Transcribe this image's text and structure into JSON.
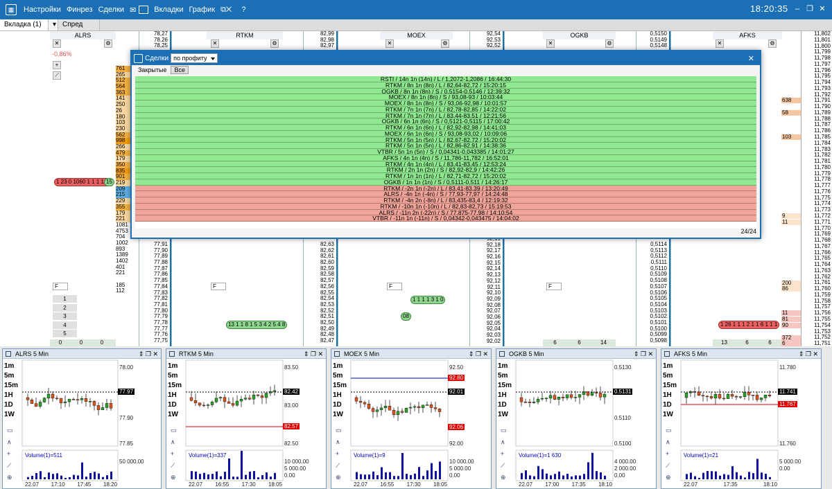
{
  "menu": {
    "items": [
      "Настройки",
      "Финрез",
      "Сделки",
      "Вкладки",
      "График"
    ],
    "clock": "18:20:35",
    "help": "?"
  },
  "tabs": {
    "tab1": "Вкладка (1)",
    "tab2": "Спред"
  },
  "instruments": [
    {
      "name": "ALRS",
      "change": "-0,86%"
    },
    {
      "name": "RTKM"
    },
    {
      "name": "MOEX"
    },
    {
      "name": "OGKB"
    },
    {
      "name": "AFKS"
    }
  ],
  "dialog": {
    "title": "Сделки",
    "filter": "по профиту",
    "sub_closed": "Закрытые",
    "sub_all": "Все",
    "counter": "24/24",
    "deals": [
      {
        "text": "RSTI / 14n 1n (14n) / L / 1,2072-1,2086 / 16:44:30",
        "result": "win"
      },
      {
        "text": "RTKM / 8n 1n (8n) / L / 82,64-82,72 / 15:20:15",
        "result": "win"
      },
      {
        "text": "OGKB / 8n 1n (8n) / S / 0,5154-0,5146 / 12:39:32",
        "result": "win"
      },
      {
        "text": "MOEX / 8n 1n (8n) / S / 93,08-93 / 10:03:44",
        "result": "win"
      },
      {
        "text": "MOEX / 8n 1n (8n) / S / 93,06-92,98 / 10:01:57",
        "result": "win"
      },
      {
        "text": "RTKM / 7n 1n (7n) / L / 82,78-82,85 / 14:22:02",
        "result": "win"
      },
      {
        "text": "RTKM / 7n 1n (7n) / L / 83,44-83,51 / 12:21:56",
        "result": "win"
      },
      {
        "text": "OGKB / 6n 1n (6n) / S / 0,5121-0,5115 / 17:00:42",
        "result": "win"
      },
      {
        "text": "RTKM / 6n 1n (6n) / L / 82,92-82,98 / 14:41:03",
        "result": "win"
      },
      {
        "text": "MOEX / 6n 1n (6n) / S / 93,08-93,02 / 10:09:06",
        "result": "win"
      },
      {
        "text": "RTKM / 5n 1n (5n) / L / 82,67-82,72 / 15:20:02",
        "result": "win"
      },
      {
        "text": "RTKM / 5n 1n (5n) / L / 82,86-82,91 / 14:38:36",
        "result": "win"
      },
      {
        "text": "VTBR / 5n 1n (5n) / S / 0,04341-0,043385 / 14:01:27",
        "result": "win"
      },
      {
        "text": "AFKS / 4n 1n (4n) / S / 11,786-11,782 / 16:52:01",
        "result": "win"
      },
      {
        "text": "RTKM / 4n 1n (4n) / L / 83,41-83,45 / 12:53:24",
        "result": "win"
      },
      {
        "text": "RTKM / 2n 1n (2n) / S / 82,92-82,9 / 14:42:26",
        "result": "win"
      },
      {
        "text": "RTKM / 1n 1n (1n) / L / 82,71-82,72 / 15:20:02",
        "result": "win"
      },
      {
        "text": "OGKB / 1n 1n (1n) / S / 0,5111-0,511 / 14:26:17",
        "result": "win"
      },
      {
        "text": "RTKM / -2n 1n (-2n) / L / 83,41-83,39 / 13:20:49",
        "result": "loss"
      },
      {
        "text": "ALRS / -4n 1n (-4n) / S / 77,93-77,97 / 14:24:48",
        "result": "loss"
      },
      {
        "text": "RTKM / -4n 2n (-8n) / L / 83,435-83,4 / 12:19:32",
        "result": "loss"
      },
      {
        "text": "RTKM / -10n 1n (-10n) / L / 82,83-82,73 / 15:19:53",
        "result": "loss"
      },
      {
        "text": "ALRS / -11n 2n (-22n) / S / 77,875-77,98 / 14:10:54",
        "result": "loss"
      },
      {
        "text": "VTBR / -11n 1n (-11n) / S / 0,04342-0,043475 / 14:04:02",
        "result": "loss"
      }
    ]
  },
  "price_ladders": {
    "alrs_top": [
      "78,27",
      "78,26",
      "78,25"
    ],
    "alrs_bottom": [
      "77,91",
      "77,90",
      "77,89",
      "77,88",
      "77,87",
      "77,86",
      "77,85",
      "77,84",
      "77,83",
      "77,82",
      "77,81",
      "77,80",
      "77,79",
      "77,78",
      "77,77",
      "77,76",
      "77,75"
    ],
    "rtkm_top": [
      "82,99",
      "82,98",
      "82,97"
    ],
    "rtkm_bottom": [
      "82,63",
      "82,62",
      "82,61",
      "82,60",
      "82,59",
      "82,58",
      "82,57",
      "82,56",
      "82,55",
      "82,54",
      "82,53",
      "82,52",
      "82,51",
      "82,50",
      "82,49",
      "82,48",
      "82,47"
    ],
    "moex_top": [
      "92,54",
      "92,53",
      "92,52"
    ],
    "moex_bottom": [
      "92,19",
      "92,18",
      "92,17",
      "92,16",
      "92,15",
      "92,14",
      "92,13",
      "92,12",
      "92,11",
      "92,10",
      "92,09",
      "92,08",
      "92,07",
      "92,06",
      "92,05",
      "92,04",
      "92,03",
      "92,02"
    ],
    "ogkb_top": [
      "0,5150",
      "0,5149",
      "0,5148"
    ],
    "ogkb_bottom": [
      "0,5114",
      "0,5113",
      "0,5112",
      "0,5111",
      "0,5110",
      "0,5109",
      "0,5108",
      "0,5107",
      "0,5106",
      "0,5105",
      "0,5104",
      "0,5103",
      "0,5102",
      "0,5101",
      "0,5100",
      "0,5099",
      "0,5098"
    ],
    "afks": [
      "11,802",
      "11,801",
      "11,800",
      "11,799",
      "11,798",
      "11,797",
      "11,796",
      "11,795",
      "11,794",
      "11,793",
      "11,792",
      "11,791",
      "11,790",
      "11,789",
      "11,788",
      "11,787",
      "11,786",
      "11,785",
      "11,784",
      "11,783",
      "11,782",
      "11,781",
      "11,780",
      "11,779",
      "11,778",
      "11,777",
      "11,776",
      "11,775",
      "11,774",
      "11,773",
      "11,772",
      "11,771",
      "11,770",
      "11,769",
      "11,768",
      "11,767",
      "11,766",
      "11,765",
      "11,764",
      "11,763",
      "11,762",
      "11,761",
      "11,760",
      "11,759",
      "11,758",
      "11,757",
      "11,756",
      "11,755",
      "11,754",
      "11,753",
      "11,752",
      "11,751",
      "11,750"
    ],
    "afks_volumes": [
      {
        "row": 11,
        "text": "638"
      },
      {
        "row": 13,
        "text": "58"
      },
      {
        "row": 17,
        "text": "103"
      },
      {
        "row": 30,
        "text": "9"
      },
      {
        "row": 31,
        "text": "11"
      },
      {
        "row": 41,
        "text": "200"
      },
      {
        "row": 42,
        "text": "86"
      },
      {
        "row": 46,
        "text": "11"
      },
      {
        "row": 47,
        "text": "81"
      },
      {
        "row": 48,
        "text": "90"
      },
      {
        "row": 50,
        "text": "372"
      },
      {
        "row": 51,
        "text": "6"
      }
    ]
  },
  "alrs_volumes": [
    "761",
    "265",
    "512",
    "564",
    "363",
    "141",
    "250",
    "26",
    "180",
    "103",
    "230",
    "562",
    "998",
    "266",
    "479",
    "179",
    "350",
    "835",
    "901",
    "219",
    "209",
    "215",
    "229",
    "355",
    "179",
    "221",
    "1081",
    "4753",
    "704",
    "1002",
    "893",
    "1389",
    "1402",
    "401",
    "221",
    "",
    "185",
    "112"
  ],
  "selector_label": "F",
  "level_numbers": [
    "1",
    "2",
    "3",
    "4",
    "5"
  ],
  "footer_counts": {
    "alrs": [
      "0",
      "0",
      "0"
    ],
    "ogkb": [
      "6",
      "6",
      "14"
    ],
    "afks": [
      "13",
      "6",
      "6"
    ],
    "times": [
      "7:5",
      "18:0",
      "17:00",
      "18:02",
      "4236",
      "2698"
    ]
  },
  "charts": [
    {
      "name": "ALRS 5 Min",
      "last": "77.97",
      "volume": "Volume(1)=511",
      "y_ticks": [
        "78.00",
        "77.95",
        "77.90",
        "77.85"
      ],
      "vol_ticks": [
        "50 000.00"
      ],
      "x_ticks": [
        "22.07",
        "17:10",
        "17:45",
        "18:20"
      ],
      "accent": "#000000"
    },
    {
      "name": "RTKM 5 Min",
      "last": "82.42",
      "upper": "82.57",
      "volume": "Volume(1)=337",
      "y_ticks": [
        "83.50",
        "83.00",
        "82.50"
      ],
      "vol_ticks": [
        "10 000.00",
        "5 000.00",
        "0.00"
      ],
      "x_ticks": [
        "22.07",
        "16:55",
        "17:30",
        "18:05"
      ],
      "accent": "#e00000"
    },
    {
      "name": "MOEX 5 Min",
      "last": "92.01",
      "upper": "92.80",
      "mid": "92.06",
      "volume": "Volume(1)=9",
      "y_ticks": [
        "92.50",
        "92.00"
      ],
      "vol_ticks": [
        "10 000.00",
        "5 000.00",
        "0.00"
      ],
      "x_ticks": [
        "22.07",
        "16:55",
        "17:30",
        "18:05"
      ],
      "accent": "#0000c0"
    },
    {
      "name": "OGKB 5 Min",
      "last": "0.5131",
      "volume": "Volume(1)=1 630",
      "y_ticks": [
        "0.5130",
        "0.5120",
        "0.5110",
        "0.5100"
      ],
      "vol_ticks": [
        "4 000.00",
        "2 000.00",
        "0.00"
      ],
      "x_ticks": [
        "22.07",
        "17:00",
        "17:35",
        "18:10"
      ],
      "accent": "#000000"
    },
    {
      "name": "AFKS 5 Min",
      "last": "11.741",
      "upper": "11.767",
      "volume": "Volume(1)=21",
      "y_ticks": [
        "11.780",
        "11.760"
      ],
      "vol_ticks": [
        "5 000.00",
        "0.00"
      ],
      "x_ticks": [
        "22.07",
        "17:35",
        "18:10"
      ],
      "accent": "#e00000"
    }
  ],
  "timeframes": [
    "1m",
    "5m",
    "15m",
    "1H",
    "1D",
    "1W"
  ],
  "colors": {
    "accent": "#1a6fb5",
    "win": "#90e890",
    "loss": "#f0a49a",
    "bid": "#f39c12",
    "ask": "#e06666"
  }
}
